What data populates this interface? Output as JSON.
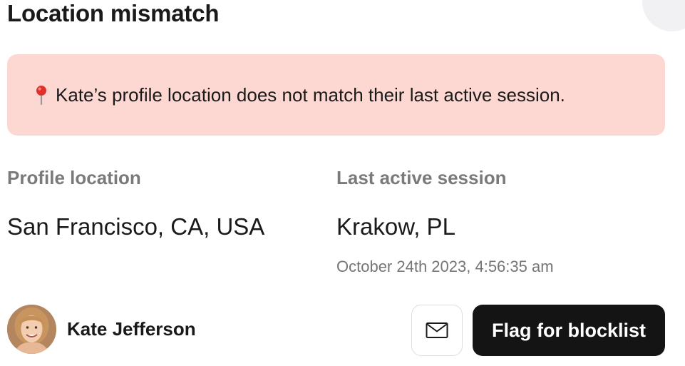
{
  "header": {
    "title": "Location mismatch"
  },
  "alert": {
    "icon": "pin-icon",
    "message": "Kate’s profile location does not match their last active session."
  },
  "profile_location": {
    "label": "Profile location",
    "value": "San Francisco, CA, USA"
  },
  "last_active_session": {
    "label": "Last active session",
    "value": "Krakow, PL",
    "timestamp": "October 24th 2023, 4:56:35 am"
  },
  "user": {
    "name": "Kate Jefferson",
    "avatar": "avatar-photo"
  },
  "actions": {
    "mail_icon": "mail-icon",
    "flag_label": "Flag for blocklist"
  },
  "colors": {
    "alert_background": "#fdd8d2",
    "primary_button": "#141414"
  }
}
